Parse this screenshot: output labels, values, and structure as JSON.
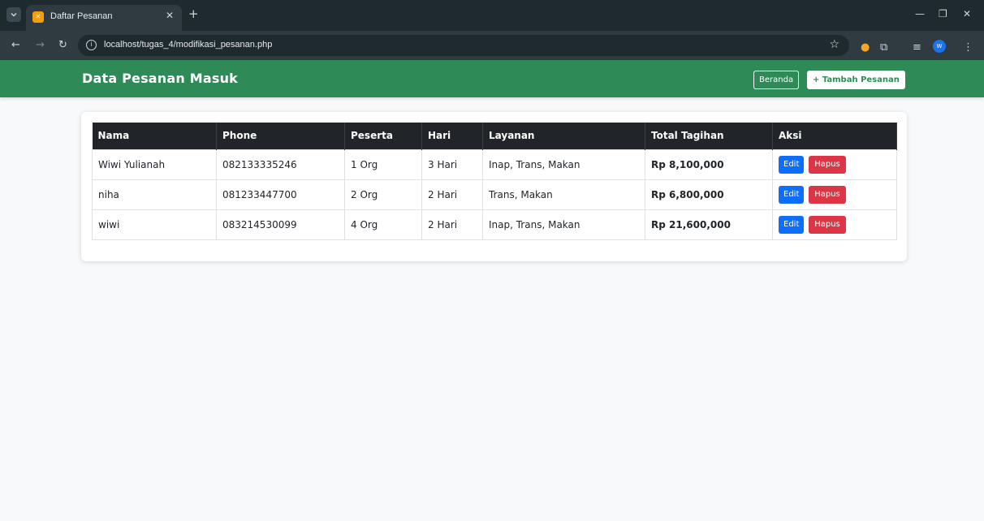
{
  "browser": {
    "tab_title": "Daftar Pesanan",
    "url": "localhost/tugas_4/modifikasi_pesanan.php",
    "profile_initial": "W"
  },
  "header": {
    "title": "Data Pesanan Masuk",
    "beranda_label": "Beranda",
    "tambah_label": "+ Tambah Pesanan"
  },
  "table": {
    "columns": [
      "Nama",
      "Phone",
      "Peserta",
      "Hari",
      "Layanan",
      "Total Tagihan",
      "Aksi"
    ],
    "rows": [
      {
        "nama": "Wiwi Yulianah",
        "phone": "082133335246",
        "peserta": "1 Org",
        "hari": "3 Hari",
        "layanan": "Inap, Trans, Makan",
        "total": "Rp 8,100,000"
      },
      {
        "nama": "niha",
        "phone": "081233447700",
        "peserta": "2 Org",
        "hari": "2 Hari",
        "layanan": "Trans, Makan",
        "total": "Rp 6,800,000"
      },
      {
        "nama": "wiwi",
        "phone": "083214530099",
        "peserta": "4 Org",
        "hari": "2 Hari",
        "layanan": "Inap, Trans, Makan",
        "total": "Rp 21,600,000"
      }
    ],
    "edit_label": "Edit",
    "hapus_label": "Hapus"
  },
  "colors": {
    "header_green": "#2e8b57",
    "table_header": "#212529",
    "edit_blue": "#0d6efd",
    "hapus_red": "#dc3545"
  }
}
